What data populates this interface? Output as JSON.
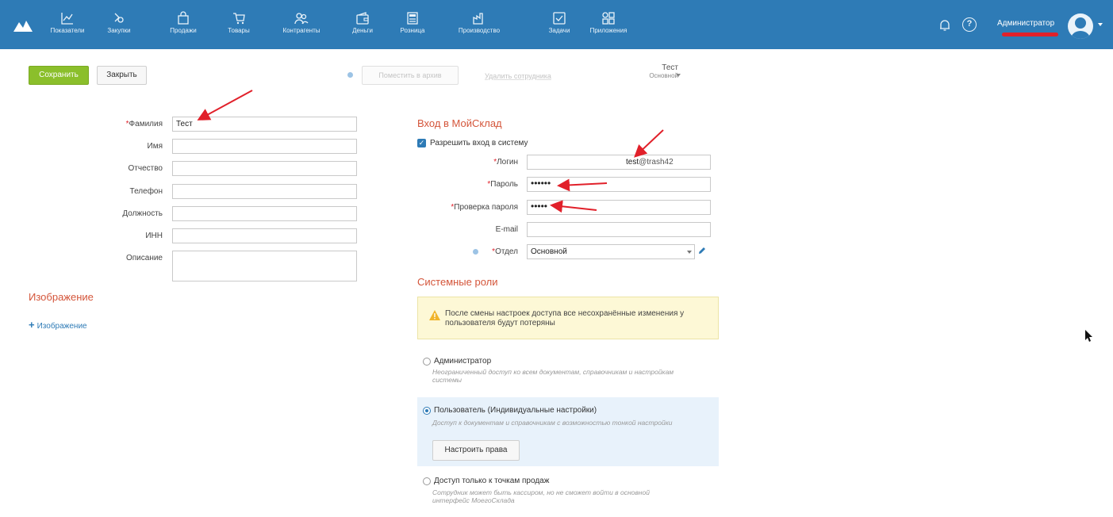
{
  "topbar": {
    "nav": [
      {
        "label": "Показатели",
        "icon": "chart-icon"
      },
      {
        "label": "Закупки",
        "icon": "purchases-icon"
      },
      {
        "label": "Продажи",
        "icon": "bag-icon"
      },
      {
        "label": "Товары",
        "icon": "cart-icon"
      },
      {
        "label": "Контрагенты",
        "icon": "contacts-icon"
      },
      {
        "label": "Деньги",
        "icon": "wallet-icon"
      },
      {
        "label": "Розница",
        "icon": "register-icon"
      },
      {
        "label": "Производство",
        "icon": "factory-icon"
      },
      {
        "label": "Задачи",
        "icon": "task-icon"
      },
      {
        "label": "Приложения",
        "icon": "apps-icon"
      }
    ],
    "user_name": "Администратор",
    "help_glyph": "?"
  },
  "toolbar": {
    "save_label": "Сохранить",
    "close_label": "Закрыть",
    "archive_label": "Поместить в архив",
    "delete_label": "Удалить сотрудника",
    "owner_name": "Тест",
    "owner_dept": "Основной"
  },
  "employee": {
    "required_mark": "*",
    "fields": [
      {
        "label": "Фамилия",
        "value": "Тест",
        "required": true
      },
      {
        "label": "Имя",
        "value": ""
      },
      {
        "label": "Отчество",
        "value": ""
      },
      {
        "label": "Телефон",
        "value": ""
      },
      {
        "label": "Должность",
        "value": ""
      },
      {
        "label": "ИНН",
        "value": ""
      },
      {
        "label": "Описание",
        "value": ""
      }
    ]
  },
  "image": {
    "title": "Изображение",
    "add_label": "Изображение",
    "add_glyph": "+"
  },
  "login": {
    "title": "Вход в МойСклад",
    "allow_label": "Разрешить вход в систему",
    "allow_checked": true,
    "login_label": "Логин",
    "login_value": "test",
    "login_suffix": "@trash42",
    "password_label": "Пароль",
    "password_value": "••••••",
    "confirm_label": "Проверка пароля",
    "confirm_value": "•••••",
    "email_label": "E-mail",
    "email_value": "",
    "dept_label": "Отдел",
    "dept_value": "Основной"
  },
  "roles": {
    "title": "Системные роли",
    "warning": "После смены настроек доступа все несохранённые изменения у пользователя будут потеряны",
    "items": [
      {
        "title": "Администратор",
        "desc": "Неограниченный доступ ко всем документам, справочникам и настройкам системы",
        "selected": false
      },
      {
        "title": "Пользователь (Индивидуальные настройки)",
        "desc": "Доступ к документам и справочникам с возможностью тонкой настройки",
        "selected": true
      },
      {
        "title": "Доступ только к точкам продаж",
        "desc": "Сотрудник может быть кассиром, но не сможет войти в основной интерфейс МоегоСклада",
        "selected": false
      }
    ],
    "rights_button": "Настроить права"
  },
  "colors": {
    "topbar": "#2e7bb6",
    "accent_green": "#8bbf2b",
    "section_title": "#d4553a",
    "annotation_arrow": "#e1202a"
  }
}
